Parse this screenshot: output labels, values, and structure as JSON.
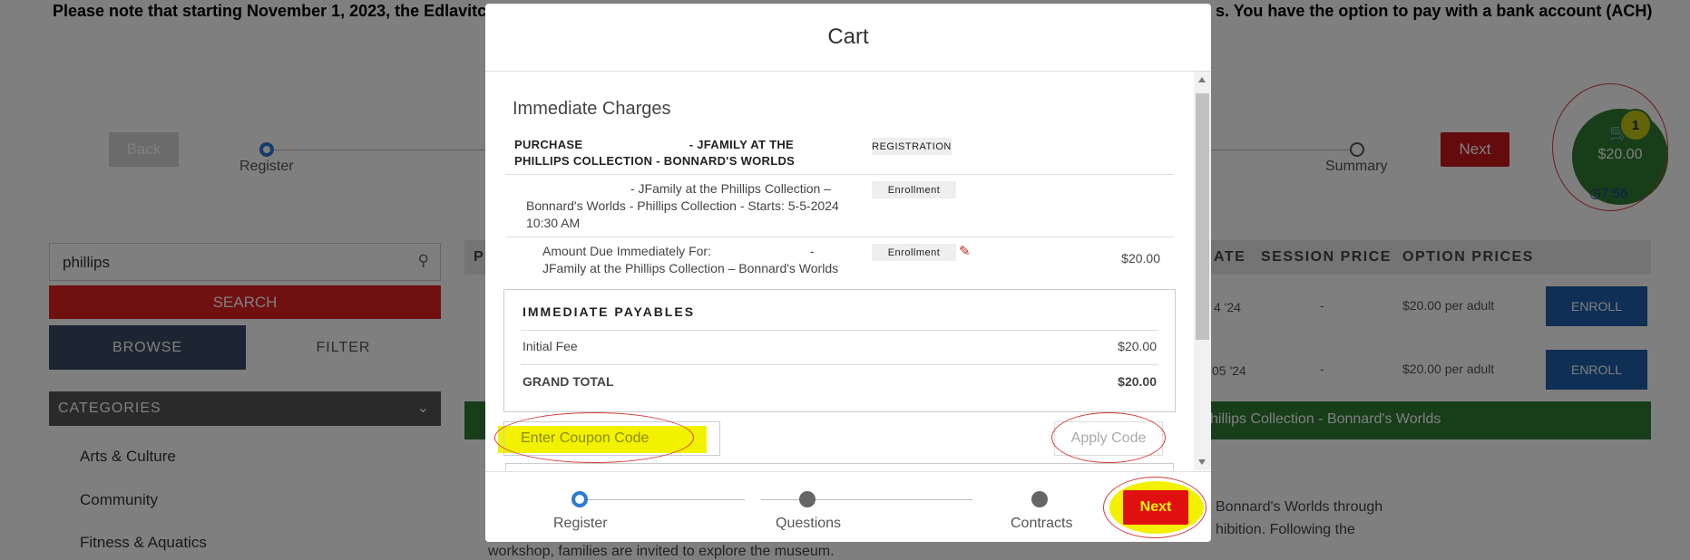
{
  "notice": {
    "left": "Please note that starting November 1, 2023, the Edlavitch",
    "right": "s.  You have the option to pay with a bank account (ACH)"
  },
  "progress": {
    "back_label": "Back",
    "next_label": "Next",
    "steps": [
      "Register",
      "Summary"
    ]
  },
  "cart_widget": {
    "count": "1",
    "amount": "$20.00",
    "timer": "7:56"
  },
  "sidebar": {
    "search_value": "phillips",
    "search_label": "SEARCH",
    "tabs": [
      "BROWSE",
      "FILTER"
    ],
    "categories_label": "CATEGORIES",
    "items": [
      "Arts & Culture",
      "Community",
      "Fitness & Aquatics"
    ]
  },
  "table": {
    "headers": [
      "P",
      "ATE",
      "SESSION PRICE",
      "OPTION PRICES"
    ],
    "rows": [
      {
        "date": "4 '24",
        "session_price": "-",
        "option_prices": "$20.00 per adult",
        "action": "ENROLL"
      },
      {
        "date": "05 '24",
        "session_price": "-",
        "option_prices": "$20.00 per adult",
        "action": "ENROLL"
      }
    ],
    "banner": "hillips Collection - Bonnard's Worlds",
    "desc_lines": [
      "Bonnard's Worlds through",
      "hibition.  Following the",
      "workshop, families are invited to explore the museum."
    ]
  },
  "modal": {
    "title": "Cart",
    "section_title": "Immediate Charges",
    "purchase": {
      "line1": "PURCHASE                              - JFAMILY AT THE",
      "line2": "PHILLIPS COLLECTION - BONNARD'S WORLDS",
      "tag": "REGISTRATION"
    },
    "enrollment": {
      "line1": "- JFamily at the Phillips Collection –",
      "line2": "Bonnard's Worlds - Phillips Collection - Starts: 5-5-2024",
      "line3": "10:30 AM",
      "tag": "Enrollment"
    },
    "amount_due": {
      "line1": "Amount Due Immediately For:                            -",
      "line2": "JFamily at the Phillips Collection – Bonnard's Worlds",
      "tag": "Enrollment",
      "amount": "$20.00"
    },
    "payables": {
      "title": "IMMEDIATE PAYABLES",
      "initial_fee_label": "Initial Fee",
      "initial_fee_value": "$20.00",
      "grand_total_label": "GRAND TOTAL",
      "grand_total_value": "$20.00"
    },
    "coupon": {
      "placeholder": "Enter Coupon Code",
      "apply_label": "Apply Code"
    },
    "footer": {
      "steps": [
        "Register",
        "Questions",
        "Contracts"
      ],
      "next_label": "Next"
    }
  },
  "colors": {
    "brand_red": "#e01010",
    "highlight_yellow": "#f2f200",
    "annotation_red": "#d63b3b",
    "cart_green": "#2e7d32",
    "enroll_blue": "#1f5fa8"
  }
}
